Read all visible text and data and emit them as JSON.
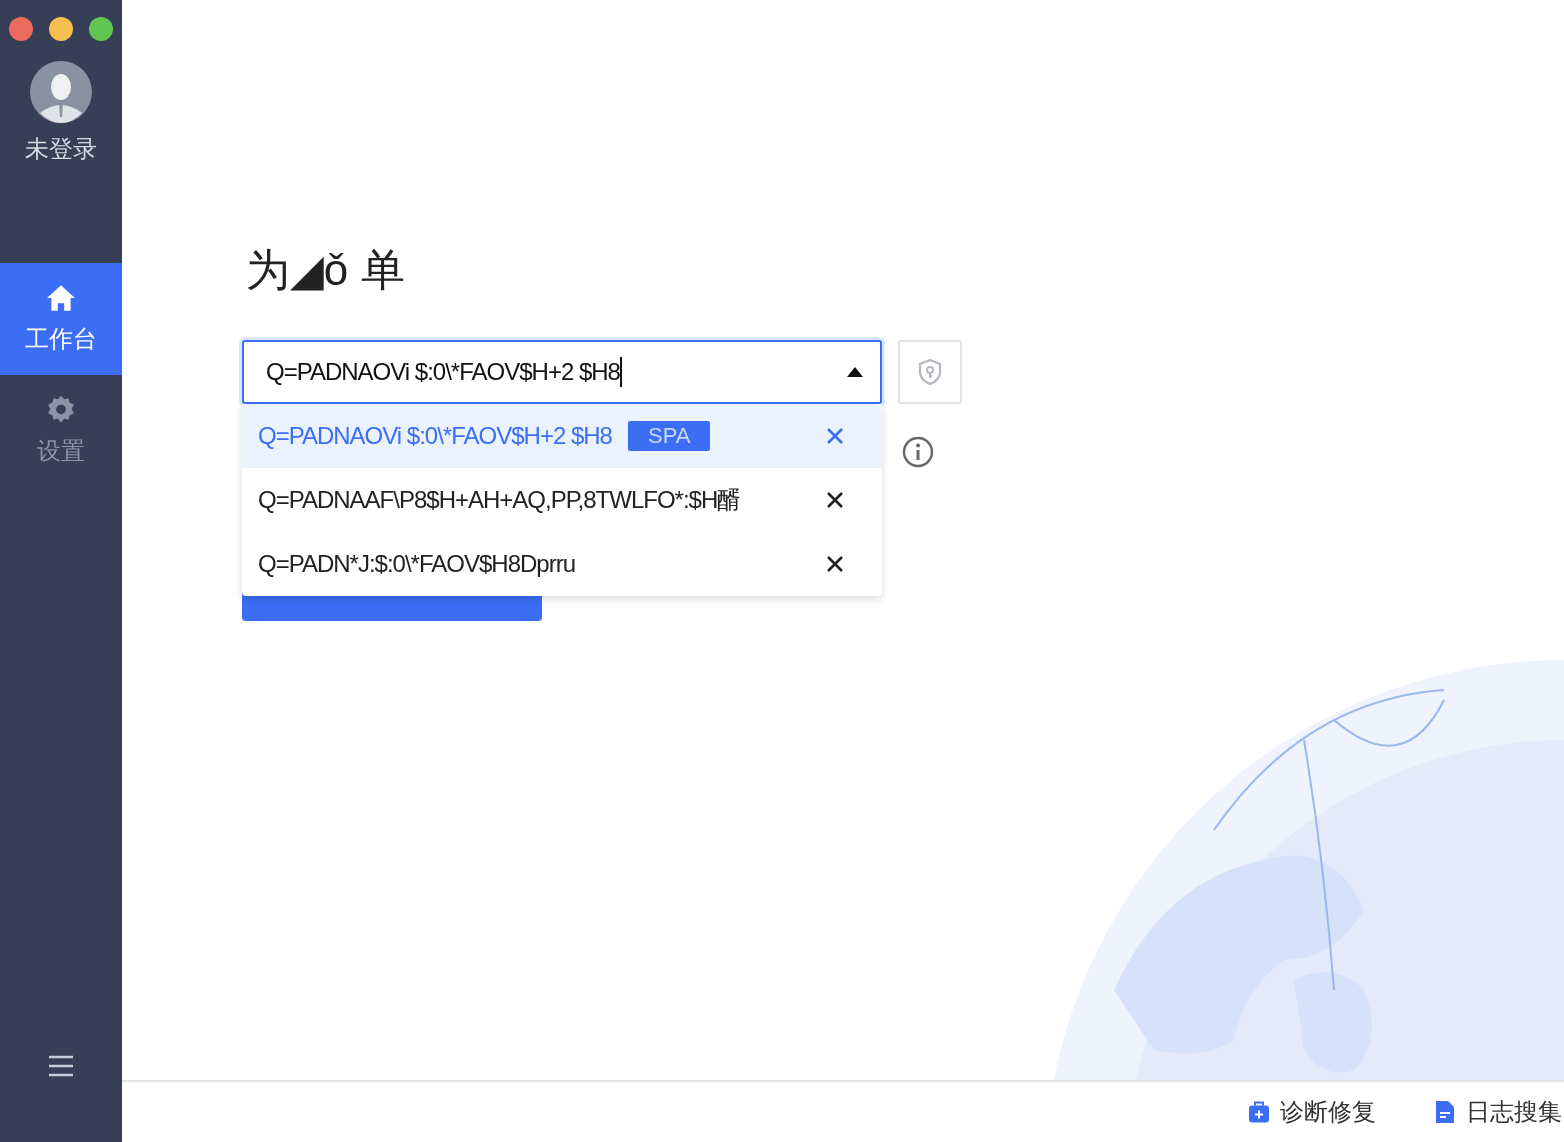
{
  "sidebar": {
    "user": {
      "label": "未登录"
    },
    "nav": [
      {
        "kind": "home",
        "label": "工作台",
        "selected": true
      },
      {
        "kind": "settings",
        "label": "设置",
        "selected": false
      }
    ]
  },
  "main": {
    "title": "为◢ǒ 单",
    "select": {
      "value": "Q=PADNAOVi $:0\\*FAOV$H+2 $H8",
      "expanded": true
    },
    "options": [
      {
        "text": "Q=PADNAOVi $:0\\*FAOV$H+2 $H8",
        "badge": "SPA",
        "selected": true
      },
      {
        "text": "Q=PADNAAF\\P8$H+AH+AQ,PP,8TWLFO*:$H醑",
        "selected": false
      },
      {
        "text": "Q=PADN*J:$:0\\*FAOV$H8Dprru",
        "selected": false
      }
    ]
  },
  "footer": [
    {
      "kind": "repair",
      "label": "诊断修复"
    },
    {
      "kind": "log",
      "label": "日志搜集"
    }
  ]
}
